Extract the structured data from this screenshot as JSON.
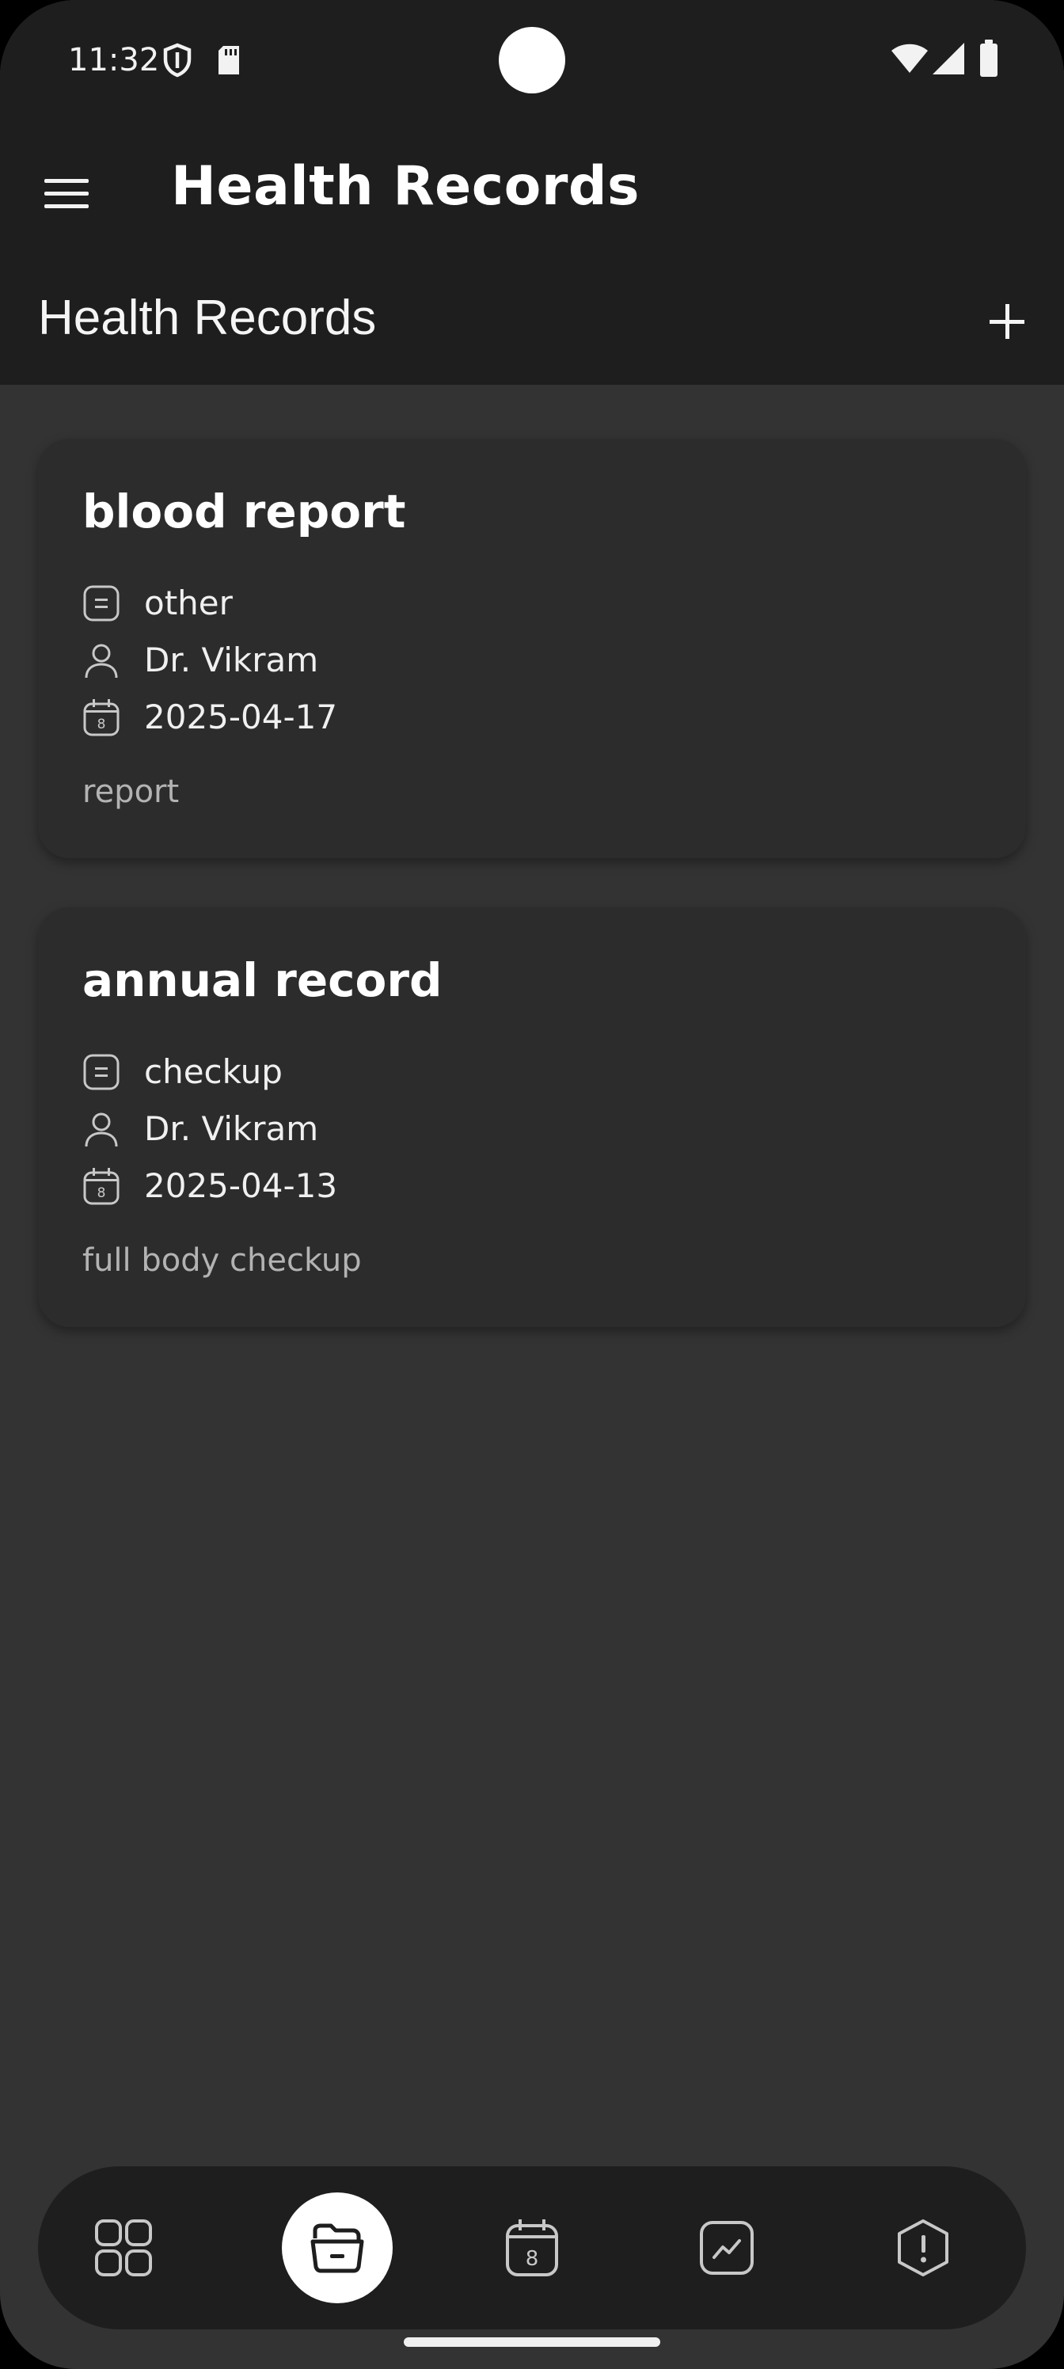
{
  "status_bar": {
    "time": "11:32",
    "icons": [
      "shield-icon",
      "sd-card-icon",
      "wifi-icon",
      "signal-icon",
      "battery-icon"
    ]
  },
  "app_bar": {
    "title": "Health Records",
    "menu_icon": "hamburger-menu-icon"
  },
  "sub_header": {
    "title": "Health Records",
    "add_icon": "plus-icon"
  },
  "records": [
    {
      "title": "blood report",
      "type": "other",
      "doctor": "Dr. Vikram",
      "date": "2025-04-17",
      "description": "report"
    },
    {
      "title": "annual record",
      "type": "checkup",
      "doctor": "Dr. Vikram",
      "date": "2025-04-13",
      "description": "full body checkup"
    }
  ],
  "bottom_nav": {
    "items": [
      "dashboard-icon",
      "records-folder-icon",
      "calendar-icon",
      "chart-icon",
      "alert-icon"
    ],
    "active_index": 1
  },
  "colors": {
    "background": "#333333",
    "bar": "#1e1e1e",
    "card": "#2c2c2c",
    "text_primary": "#ffffff",
    "text_secondary": "#b3b3b3"
  }
}
